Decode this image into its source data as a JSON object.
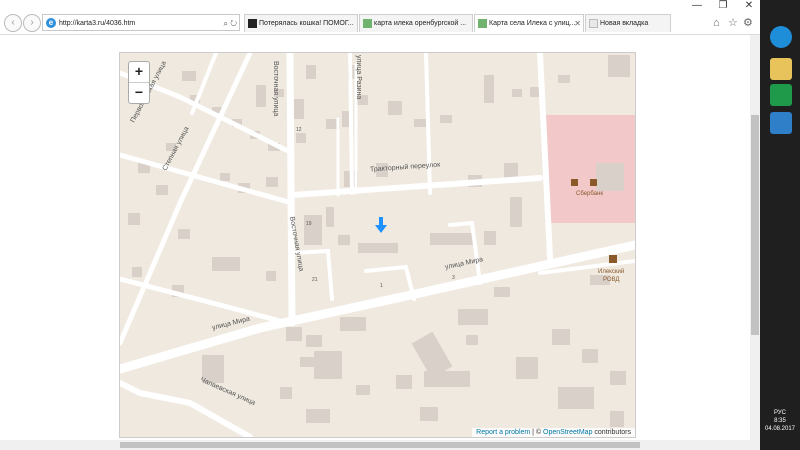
{
  "window": {
    "minimize": "—",
    "restore": "❐",
    "close": "✕"
  },
  "nav": {
    "back": "‹",
    "forward": "›",
    "address": "http://karta3.ru/4036.htm",
    "search_glyph": "⌕",
    "refresh_glyph": "↻",
    "home_glyph": "⌂",
    "favorites_glyph": "☆",
    "settings_glyph": "⚙"
  },
  "tabs": [
    {
      "label": "Потерялась кошка! ПОМОГ...",
      "icon": "page-icon"
    },
    {
      "label": "карта илека оренбургской ...",
      "icon": "map-icon"
    },
    {
      "label": "Карта села Илека с улиц...",
      "icon": "map-icon",
      "close": "✕"
    },
    {
      "label": "Новая вкладка",
      "icon": "newtab-icon"
    }
  ],
  "map": {
    "zoom_in": "+",
    "zoom_out": "−",
    "streets": {
      "tractor_lane": "Тракторный переулок",
      "mira1": "улица Мира",
      "mira2": "улица Мира",
      "vostochnaya1": "Восточная улица",
      "vostochnaya2": "Восточная улица",
      "stepnaya": "Степная улица",
      "pervomayskaya": "Первомайская улица",
      "razina": "улица Разина",
      "chapaevskaya": "Чапаевская улица"
    },
    "house_numbers": {
      "h12": "12",
      "h19": "19",
      "h21": "21",
      "h1": "1",
      "h3": "3"
    },
    "pois": {
      "sberbank": "Сбербанк",
      "rovd_1": "Илекский",
      "rovd_2": "РОВД"
    },
    "attribution": {
      "report": "Report a problem",
      "sep": " | © ",
      "osm": "OpenStreetMap",
      "contrib": " contributors"
    },
    "colors": {
      "background": "#efe9df",
      "building": "#d9d0c9",
      "road": "#ffffff",
      "bank_area": "#f2c8c8"
    }
  },
  "taskbar": {
    "lang": "РУС",
    "time": "8:35",
    "date": "04.08.2017"
  }
}
